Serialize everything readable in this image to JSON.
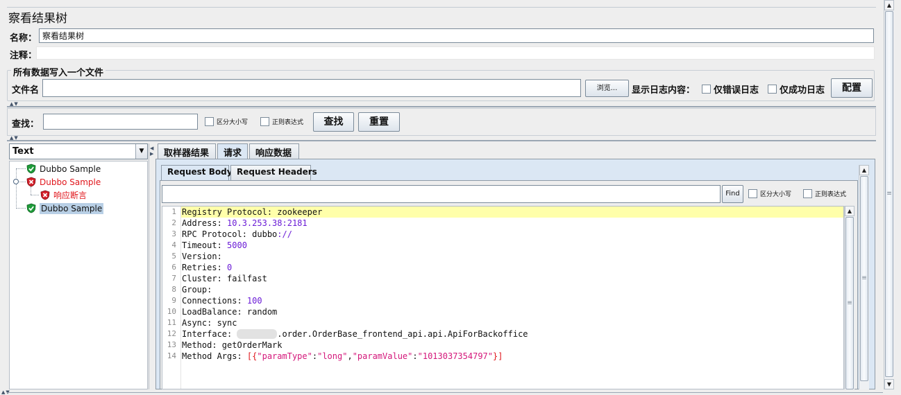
{
  "panel": {
    "title": "察看结果树"
  },
  "form": {
    "name_label": "名称：",
    "name_value": "察看结果树",
    "comment_label": "注释："
  },
  "file_section": {
    "legend": "所有数据写入一个文件",
    "filename_label": "文件名",
    "filename_value": "",
    "browse_label": "浏览...",
    "log_label": "显示日志内容：",
    "errors_only_label": "仅错误日志",
    "success_only_label": "仅成功日志",
    "config_label": "配置"
  },
  "search": {
    "label": "查找：",
    "value": "",
    "case_label": "区分大小写",
    "regex_label": "正则表达式",
    "find_label": "查找",
    "reset_label": "重置"
  },
  "renderer": {
    "selected": "Text"
  },
  "tree": [
    {
      "label": "Dubbo Sample",
      "status": "success"
    },
    {
      "label": "Dubbo Sample",
      "status": "failure"
    },
    {
      "label": "响应断言",
      "status": "failure"
    },
    {
      "label": "Dubbo Sample",
      "status": "success",
      "selected": true
    }
  ],
  "result_tabs": [
    {
      "label": "取样器结果"
    },
    {
      "label": "请求",
      "active": true
    },
    {
      "label": "响应数据"
    }
  ],
  "request_tabs": [
    {
      "label": "Request Body",
      "active": true
    },
    {
      "label": "Request Headers"
    }
  ],
  "inner_search": {
    "value": "",
    "find_label": "Find",
    "case_label": "区分大小写",
    "regex_label": "正则表达式"
  },
  "code": {
    "line_numbers": [
      "1",
      "2",
      "3",
      "4",
      "5",
      "6",
      "7",
      "8",
      "9",
      "10",
      "11",
      "12",
      "13",
      "14"
    ],
    "lines": [
      [
        {
          "t": "Registry Protocol: zookeeper",
          "c": ""
        }
      ],
      [
        {
          "t": "Address: ",
          "c": ""
        },
        {
          "t": "10.3.253.38:2181",
          "c": "num"
        }
      ],
      [
        {
          "t": "RPC Protocol: dubbo",
          "c": ""
        },
        {
          "t": "://",
          "c": "num"
        }
      ],
      [
        {
          "t": "Timeout: ",
          "c": ""
        },
        {
          "t": "5000",
          "c": "num"
        }
      ],
      [
        {
          "t": "Version:",
          "c": ""
        }
      ],
      [
        {
          "t": "Retries: ",
          "c": ""
        },
        {
          "t": "0",
          "c": "num"
        }
      ],
      [
        {
          "t": "Cluster: failfast",
          "c": ""
        }
      ],
      [
        {
          "t": "Group:",
          "c": ""
        }
      ],
      [
        {
          "t": "Connections: ",
          "c": ""
        },
        {
          "t": "100",
          "c": "num"
        }
      ],
      [
        {
          "t": "LoadBalance: random",
          "c": ""
        }
      ],
      [
        {
          "t": "Async: sync",
          "c": ""
        }
      ],
      [
        {
          "t": "Interface: ",
          "c": ""
        },
        {
          "t": "        ",
          "c": "blur"
        },
        {
          "t": ".order.OrderBase_frontend_api.api.ApiForBackoffice",
          "c": ""
        }
      ],
      [
        {
          "t": "Method: getOrderMark",
          "c": ""
        }
      ],
      [
        {
          "t": "Method Args: ",
          "c": ""
        },
        {
          "t": "[{",
          "c": "red"
        },
        {
          "t": "\"paramType\"",
          "c": "str"
        },
        {
          "t": ":",
          "c": ""
        },
        {
          "t": "\"long\"",
          "c": "str"
        },
        {
          "t": ",",
          "c": ""
        },
        {
          "t": "\"paramValue\"",
          "c": "str"
        },
        {
          "t": ":",
          "c": ""
        },
        {
          "t": "\"1013037354797\"",
          "c": "str"
        },
        {
          "t": "}]",
          "c": "red"
        }
      ]
    ]
  },
  "colors": {
    "selection": "#b8cfe5",
    "current_line": "#ffffaa",
    "error_text": "#e0151b"
  }
}
